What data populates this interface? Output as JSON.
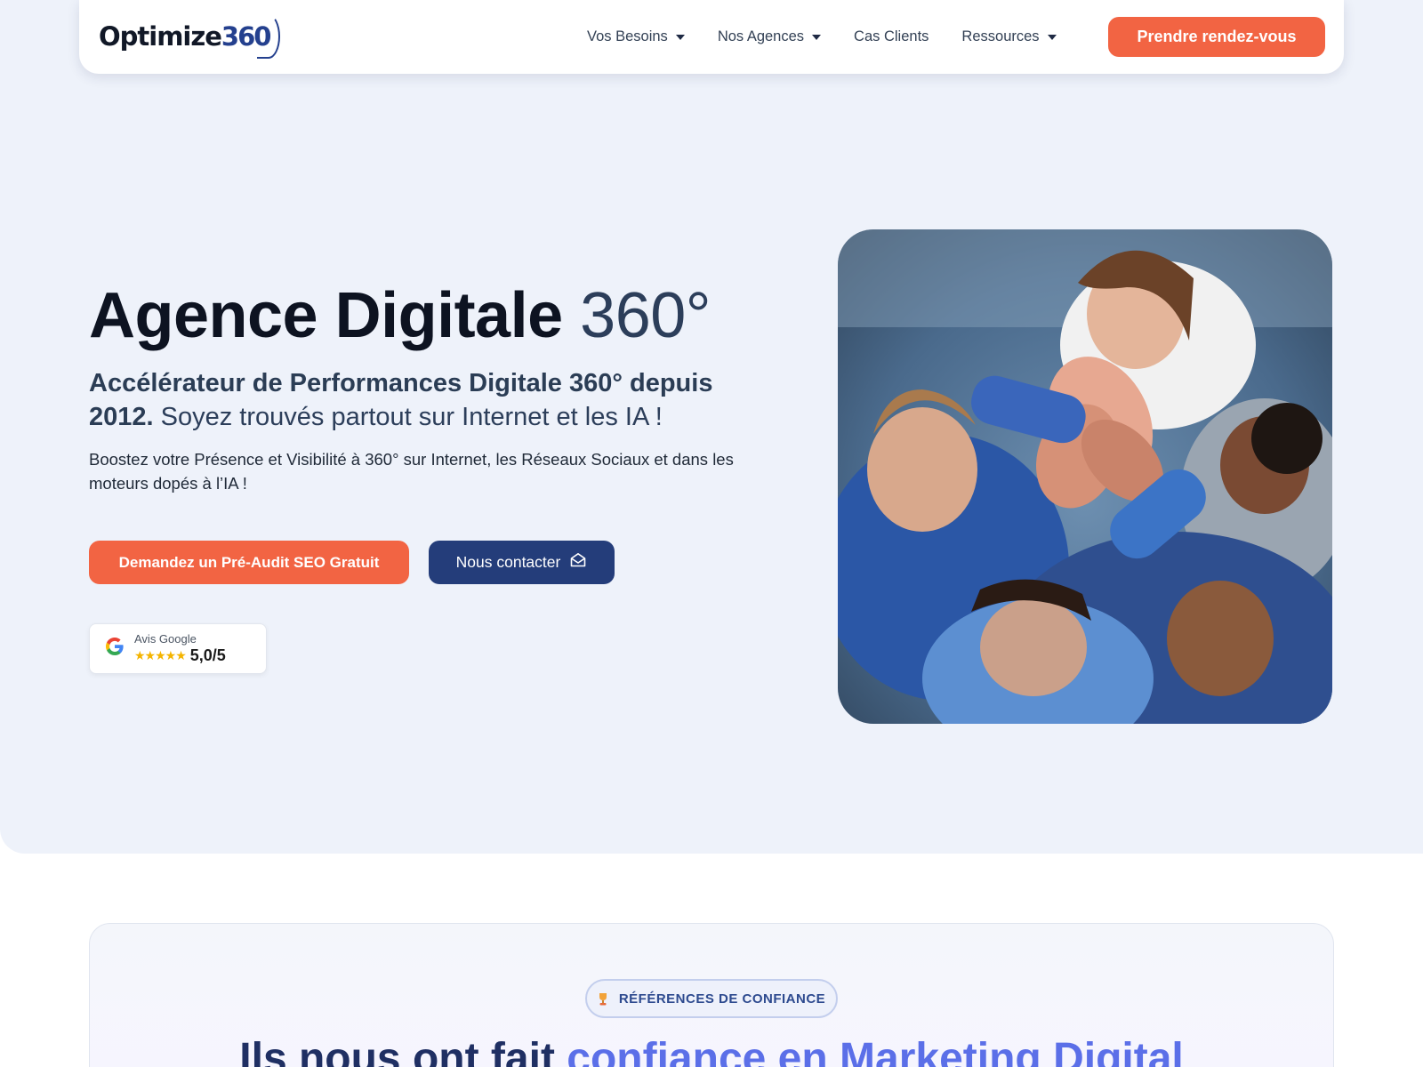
{
  "nav": {
    "logo_word": "Optimize",
    "logo_num": "360",
    "items": [
      {
        "label": "Vos Besoins",
        "dropdown": true
      },
      {
        "label": "Nos Agences",
        "dropdown": true
      },
      {
        "label": "Cas Clients",
        "dropdown": false
      },
      {
        "label": "Ressources",
        "dropdown": true
      }
    ],
    "cta_label": "Prendre rendez-vous"
  },
  "hero": {
    "title_bold": "Agence Digitale",
    "title_light": "360°",
    "subtitle_bold": "Accélérateur de Performances Digitale 360° depuis 2012.",
    "subtitle_rest": "Soyez trouvés partout sur Internet et les IA !",
    "description": "Boostez votre Présence et Visibilité à 360° sur Internet, les Réseaux Sociaux et dans les moteurs dopés à l’IA !",
    "btn_audit": "Demandez un Pré-Audit SEO Gratuit",
    "btn_contact": "Nous contacter",
    "review_label": "Avis Google",
    "review_stars": "★★★★★",
    "review_score": "5,0/5"
  },
  "refs": {
    "badge": "RÉFÉRENCES DE CONFIANCE",
    "heading_a": "Ils nous ont fait",
    "heading_b": "confiance en Marketing Digital"
  },
  "colors": {
    "accent": "#f26443",
    "primary": "#243d7a",
    "hero_bg": "#eef2fa"
  },
  "icons": {
    "contact": "envelope-open-icon",
    "google": "google-g-icon",
    "badge": "trophy-icon"
  }
}
